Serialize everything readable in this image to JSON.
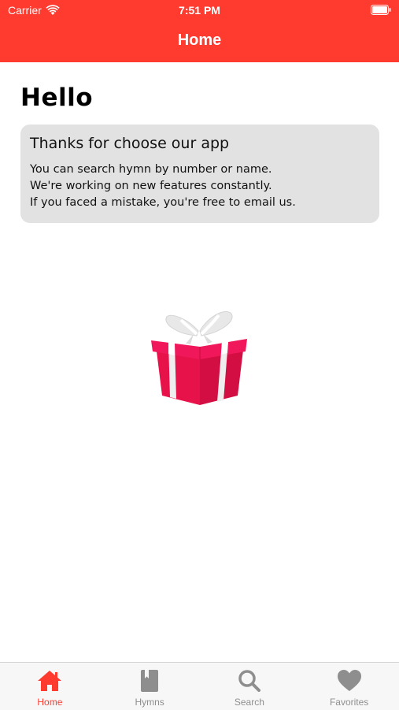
{
  "status_bar": {
    "carrier": "Carrier",
    "time": "7:51 PM",
    "wifi_icon": "wifi-icon",
    "battery_icon": "battery-icon"
  },
  "header": {
    "title": "Home",
    "color": "#FF3B30"
  },
  "greeting": "Hello",
  "card": {
    "title": "Thanks for choose our app",
    "lines": [
      "You can search hymn by number or name.",
      "We're working on new features constantly.",
      "If you faced a mistake, you're free to email us."
    ],
    "background": "#e2e2e2"
  },
  "illustration": {
    "icon": "gift-box-icon",
    "color": "#E8124A"
  },
  "tabs": [
    {
      "label": "Home",
      "icon": "home-icon",
      "active": true
    },
    {
      "label": "Hymns",
      "icon": "book-icon",
      "active": false
    },
    {
      "label": "Search",
      "icon": "search-icon",
      "active": false
    },
    {
      "label": "Favorites",
      "icon": "heart-icon",
      "active": false
    }
  ],
  "colors": {
    "accent": "#FF3B30",
    "tab_inactive": "#8e8e8e"
  }
}
